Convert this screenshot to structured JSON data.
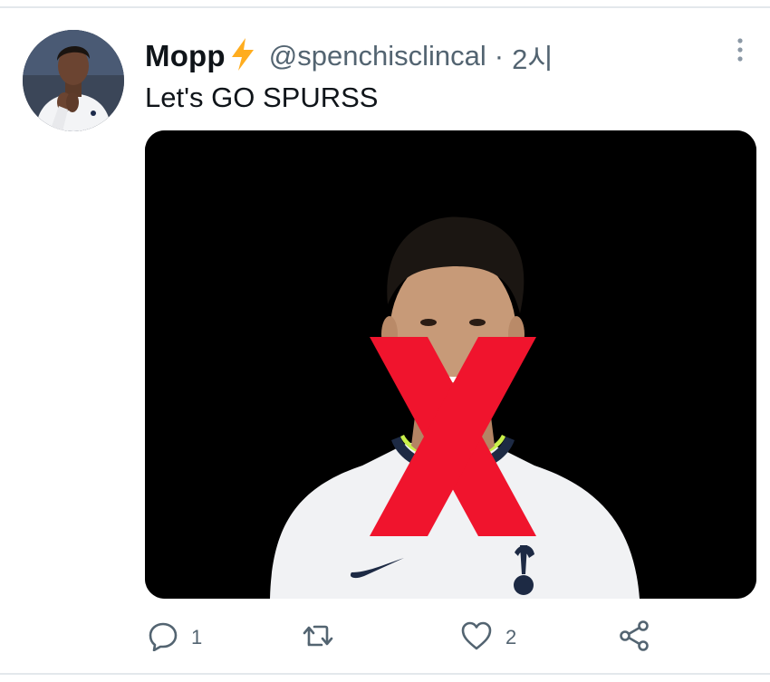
{
  "tweet": {
    "display_name": "Mopp",
    "handle": "@spenchisclincal",
    "separator": "·",
    "time": "2시",
    "text": "Let's GO SPURSS",
    "badge_icon": "lightning-bolt-icon",
    "media_alt": "player in white kit with red X over face"
  },
  "actions": {
    "reply_count": "1",
    "retweet_count": "",
    "like_count": "2",
    "reply_icon": "reply-icon",
    "retweet_icon": "retweet-icon",
    "like_icon": "heart-icon",
    "share_icon": "share-icon"
  },
  "colors": {
    "name": "#0f1419",
    "secondary": "#536471",
    "bolt": "#ffad1f",
    "red_x": "#f0142d",
    "divider": "#e3e8ec",
    "media_bg": "#000000"
  }
}
